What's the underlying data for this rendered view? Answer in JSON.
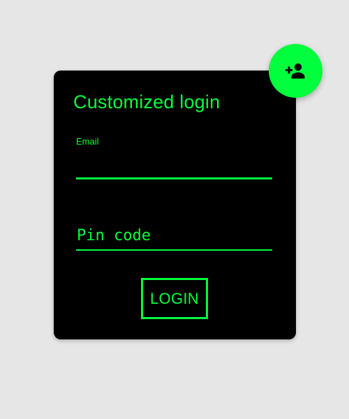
{
  "card": {
    "title": "Customized login",
    "email_label": "Email",
    "email_value": "",
    "pin_placeholder": "Pin code",
    "pin_value": "",
    "login_label": "LOGIN"
  },
  "fab": {
    "icon": "add-person-icon"
  },
  "colors": {
    "accent": "#00ff3c",
    "card_background": "#000000",
    "page_background": "#e6e6e7"
  }
}
